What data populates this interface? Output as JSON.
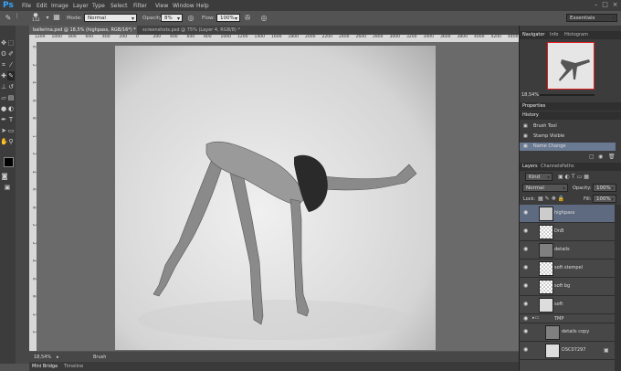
{
  "app": {
    "logo": "Ps"
  },
  "menu": [
    "File",
    "Edit",
    "Image",
    "Layer",
    "Type",
    "Select",
    "Filter",
    "View",
    "Window",
    "Help"
  ],
  "options": {
    "brush_size": "112",
    "mode_label": "Mode:",
    "mode_value": "Normal",
    "opacity_label": "Opacity:",
    "opacity_value": "8%",
    "flow_label": "Flow:",
    "flow_value": "100%",
    "workspace": "Essentials"
  },
  "tabs": [
    {
      "label": "ballerina.psd @ 18,5% (highpass, RGB/16*) *",
      "active": true
    },
    {
      "label": "screenshots.psd @ 75% (Layer 4, RGB/8) *",
      "active": false
    }
  ],
  "ruler": [
    "1200",
    "1000",
    "800",
    "600",
    "400",
    "200",
    "0",
    "200",
    "400",
    "600",
    "800",
    "1000",
    "1200",
    "1400",
    "1600",
    "1800",
    "2000",
    "2200",
    "2400",
    "2600",
    "2800",
    "3000",
    "3200",
    "3400",
    "3600",
    "3800",
    "4000",
    "4200",
    "4400",
    "4600"
  ],
  "ruler_left": [
    "0",
    "2",
    "4",
    "6",
    "8",
    "1",
    "2",
    "4",
    "6",
    "8",
    "2",
    "2",
    "4",
    "6",
    "8",
    "3",
    "2"
  ],
  "status": {
    "zoom": "18,54%",
    "tool": "Brush"
  },
  "bottom_tabs": [
    "Mini Bridge",
    "Timeline"
  ],
  "navigator": {
    "tabs": [
      "Navigator",
      "Info",
      "Histogram"
    ],
    "zoom": "18,54%"
  },
  "properties": {
    "title": "Properties"
  },
  "history": {
    "title": "History",
    "items": [
      "Brush Tool",
      "Stamp Visible",
      "Name Change"
    ]
  },
  "layers_panel": {
    "tabs": [
      "Layers",
      "Channels",
      "Paths"
    ],
    "kind_label": "Kind",
    "blend_mode": "Normal",
    "opacity_label": "Opacity:",
    "opacity_value": "100%",
    "lock_label": "Lock:",
    "fill_label": "Fill:",
    "fill_value": "100%",
    "layers": [
      "highpass",
      "DnB",
      "details",
      "soft stempel",
      "soft bg",
      "soft",
      "TMP",
      "details copy",
      "DSC07297"
    ]
  }
}
